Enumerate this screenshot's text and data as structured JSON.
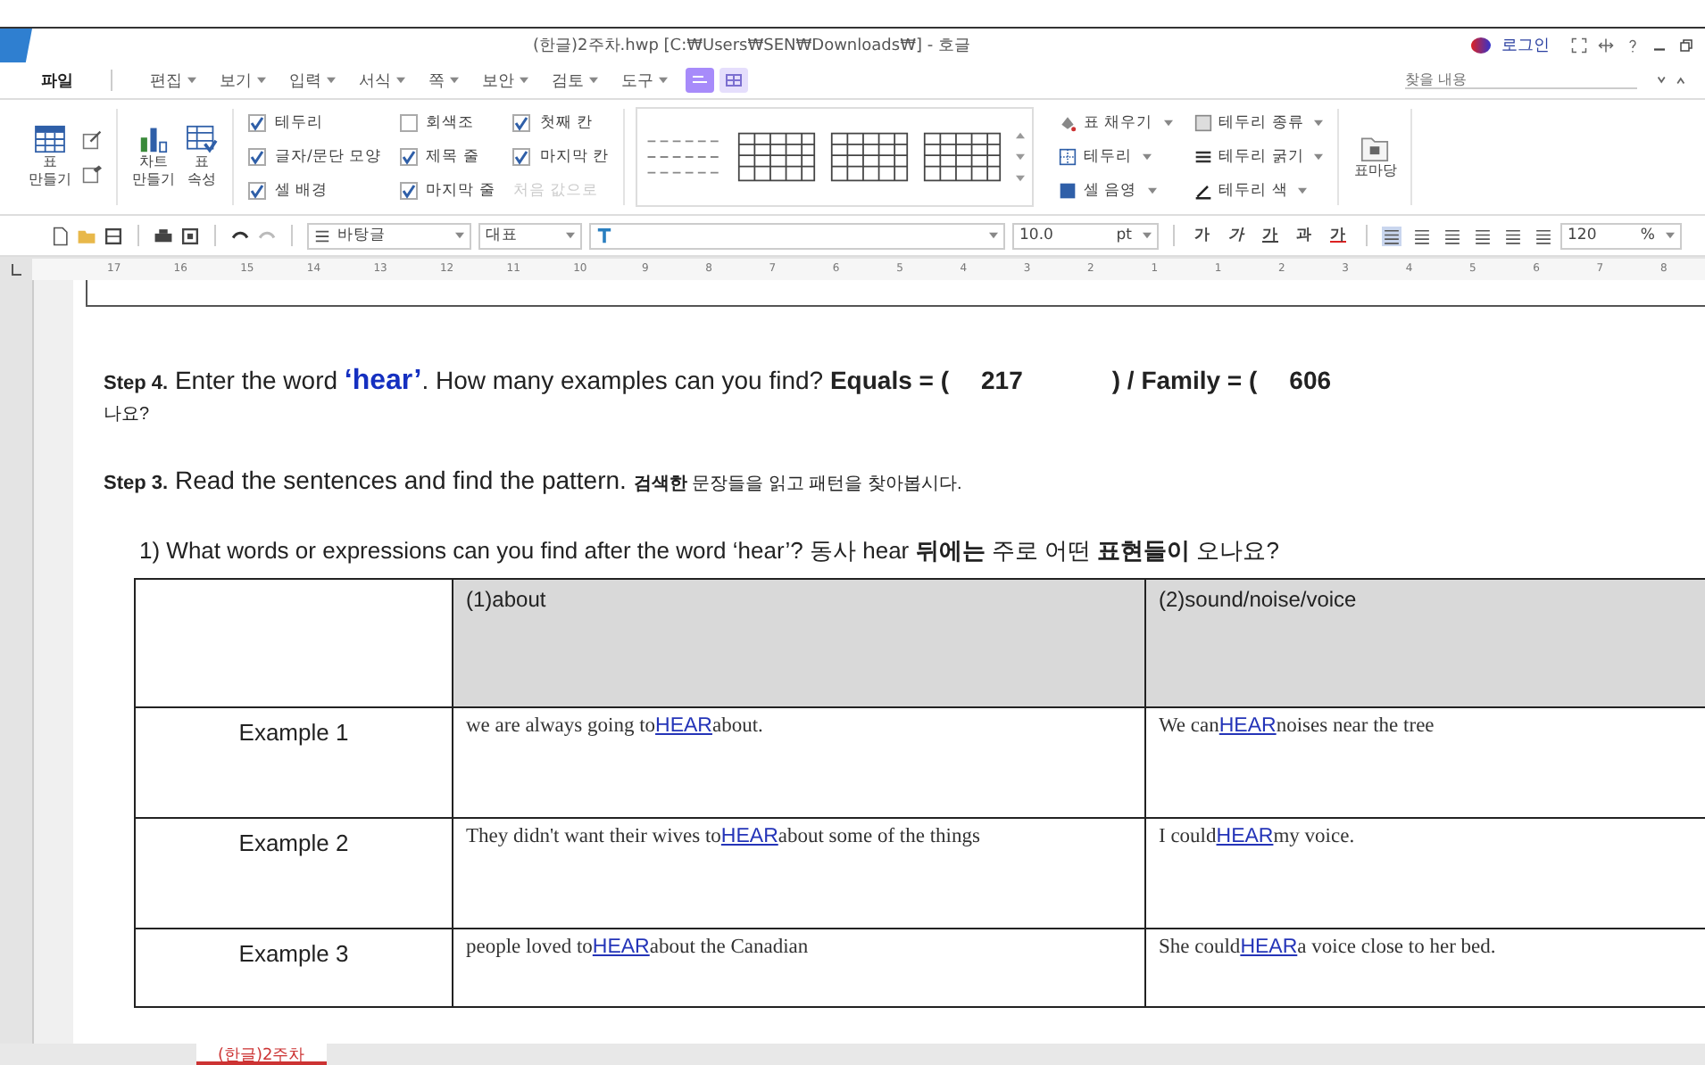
{
  "window": {
    "title": "(한글)2주차.hwp [C:₩Users₩SEN₩Downloads₩] - 호글",
    "login": "로그인"
  },
  "search": {
    "placeholder": "찾을 내용"
  },
  "menu": [
    {
      "label": "파일",
      "selected": true
    },
    {
      "label": "편집",
      "selected": false
    },
    {
      "label": "보기",
      "selected": false
    },
    {
      "label": "입력",
      "selected": false
    },
    {
      "label": "서식",
      "selected": false
    },
    {
      "label": "쪽",
      "selected": false
    },
    {
      "label": "보안",
      "selected": false
    },
    {
      "label": "검토",
      "selected": false
    },
    {
      "label": "도구",
      "selected": false
    }
  ],
  "ribbon": {
    "make_table": "표\n만들기",
    "make_chart": "차트\n만들기",
    "table_props": "표\n속성",
    "checks": [
      {
        "label": "테두리",
        "checked": true
      },
      {
        "label": "회색조",
        "checked": false
      },
      {
        "label": "첫째 칸",
        "checked": true
      },
      {
        "label": "글자/문단 모양",
        "checked": true
      },
      {
        "label": "제목 줄",
        "checked": true
      },
      {
        "label": "마지막 칸",
        "checked": true
      },
      {
        "label": "셀 배경",
        "checked": true
      },
      {
        "label": "마지막 줄",
        "checked": true
      }
    ],
    "reset": "처음 값으로",
    "tools": [
      {
        "label": "표 채우기",
        "kind": "fill"
      },
      {
        "label": "테두리 종류",
        "kind": "style"
      },
      {
        "label": "테두리",
        "kind": "border"
      },
      {
        "label": "테두리 굵기",
        "kind": "width"
      },
      {
        "label": "셀 음영",
        "kind": "shade"
      },
      {
        "label": "테두리 색",
        "kind": "color"
      }
    ],
    "table_gallery": "표마당"
  },
  "toolbar": {
    "style": "바탕글",
    "font_lang": "대표",
    "size": "10.0",
    "unit": "pt",
    "format": [
      {
        "label": "가",
        "kind": "bold"
      },
      {
        "label": "가",
        "kind": "italic"
      },
      {
        "label": "가",
        "kind": "underline"
      },
      {
        "label": "과",
        "kind": "strike"
      },
      {
        "label": "가",
        "kind": "color"
      }
    ],
    "zoom": "120",
    "zoom_unit": "%"
  },
  "ruler": [
    "17",
    "16",
    "15",
    "14",
    "13",
    "12",
    "11",
    "10",
    "9",
    "8",
    "7",
    "6",
    "5",
    "4",
    "3",
    "2",
    "1",
    "1",
    "2",
    "3",
    "4",
    "5",
    "6",
    "7",
    "8"
  ],
  "document": {
    "step4": {
      "label": "Step 4.",
      "parts": [
        {
          "text": "Enter the word ",
          "kind": "plain"
        },
        {
          "text": "‘hear’",
          "kind": "keyword"
        },
        {
          "text": ". How many examples can you find? ",
          "kind": "plain"
        },
        {
          "text": "Equals = (",
          "kind": "strong"
        },
        {
          "text": "217",
          "kind": "value"
        },
        {
          "text": ") / Family = (",
          "kind": "strong"
        },
        {
          "text": "606",
          "kind": "value"
        }
      ],
      "continuation": "나요?"
    },
    "step3": {
      "label": "Step 3.",
      "text": "Read the sentences and find the pattern.",
      "korean": "**검색한** 문장들을 읽고 패턴을 찾아봅시다."
    },
    "question": "1) What words or expressions can you find after the word ‘hear’? 동사 hear **뒤에는** 주로 어떤 **표현들이** 오나요?",
    "table": {
      "columns": [
        "(1)about",
        "(2)sound/noise/voice"
      ],
      "rows": [
        {
          "label": "Example 1",
          "cells": [
            {
              "before": "we are always going to",
              "link": "HEAR",
              "after": "about."
            },
            {
              "before": "We can",
              "link": "HEAR",
              "after": "noises near the tree"
            }
          ]
        },
        {
          "label": "Example 2",
          "cells": [
            {
              "before": "They didn't want their wives to",
              "link": "HEAR",
              "after": "about some of the things"
            },
            {
              "before": "I could",
              "link": "HEAR",
              "after": "my voice."
            }
          ]
        },
        {
          "label": "Example 3",
          "cells": [
            {
              "before": "people loved to",
              "link": "HEAR",
              "after": "about the Canadian"
            },
            {
              "before": "She could",
              "link": "HEAR",
              "after": "a voice close to her bed."
            }
          ]
        }
      ]
    }
  },
  "doc_tabs": [
    {
      "label": "(한글)2주차",
      "selected": true
    }
  ]
}
